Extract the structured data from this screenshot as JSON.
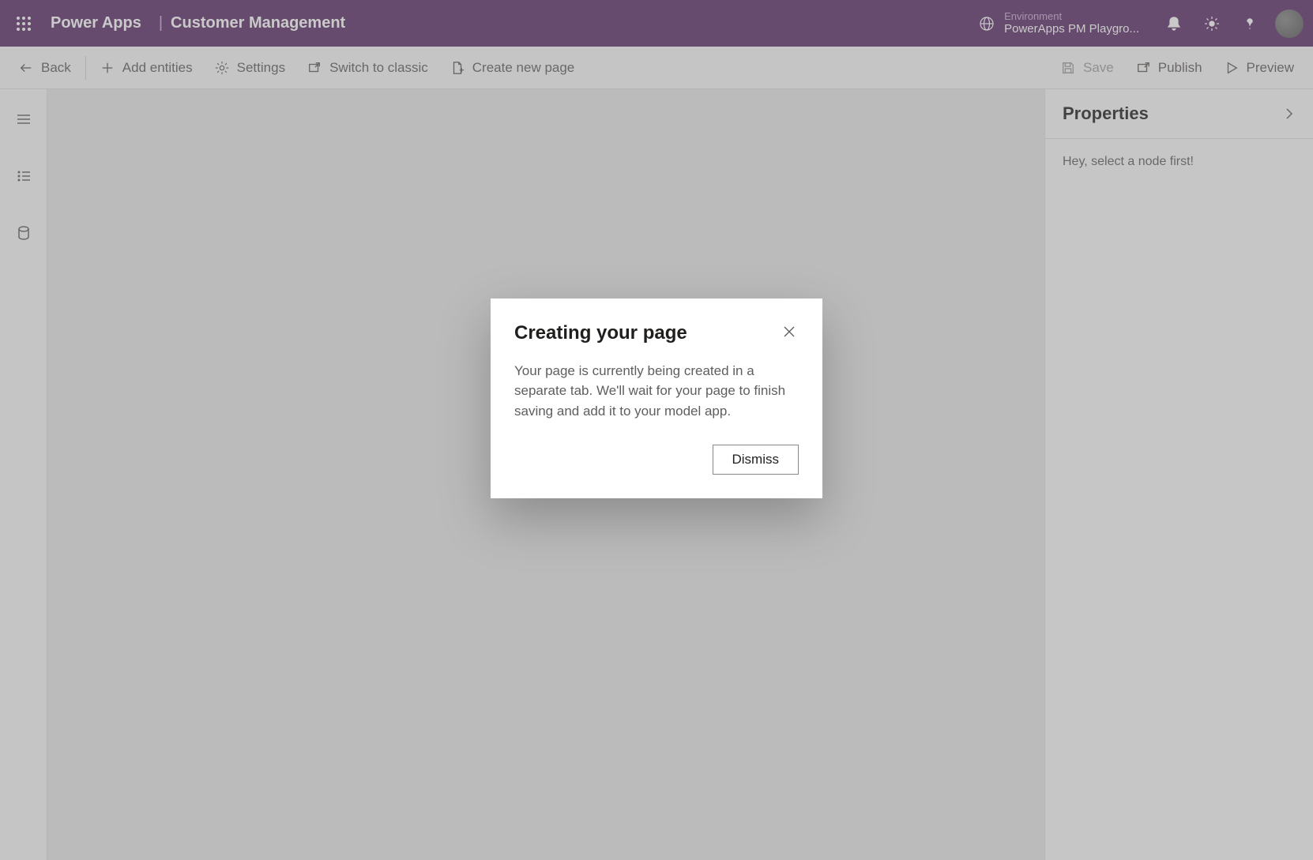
{
  "header": {
    "app_title": "Power Apps",
    "separator": "|",
    "page_name": "Customer Management",
    "environment_label": "Environment",
    "environment_value": "PowerApps PM Playgro..."
  },
  "command_bar": {
    "back": "Back",
    "add_entities": "Add entities",
    "settings": "Settings",
    "switch_classic": "Switch to classic",
    "create_page": "Create new page",
    "save": "Save",
    "publish": "Publish",
    "preview": "Preview"
  },
  "properties": {
    "title": "Properties",
    "empty_message": "Hey, select a node first!"
  },
  "modal": {
    "title": "Creating your page",
    "body": "Your page is currently being created in a separate tab. We'll wait for your page to finish saving and add it to your model app.",
    "dismiss": "Dismiss"
  }
}
